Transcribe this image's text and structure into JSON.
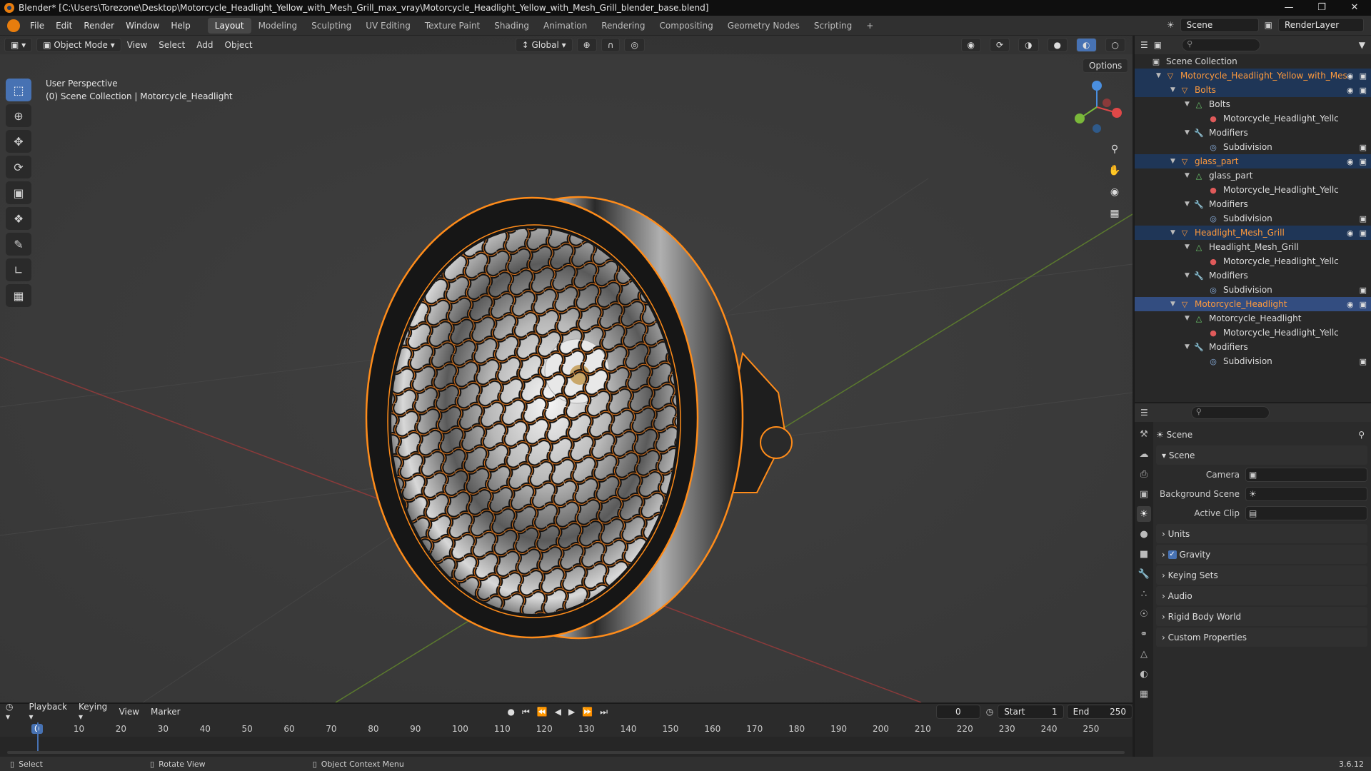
{
  "window": {
    "title": "Blender* [C:\\Users\\Torezone\\Desktop\\Motorcycle_Headlight_Yellow_with_Mesh_Grill_max_vray\\Motorcycle_Headlight_Yellow_with_Mesh_Grill_blender_base.blend]"
  },
  "menu": [
    "File",
    "Edit",
    "Render",
    "Window",
    "Help"
  ],
  "workspaces": [
    "Layout",
    "Modeling",
    "Sculpting",
    "UV Editing",
    "Texture Paint",
    "Shading",
    "Animation",
    "Rendering",
    "Compositing",
    "Geometry Nodes",
    "Scripting"
  ],
  "active_workspace": "Layout",
  "scene_name": "Scene",
  "render_layer": "RenderLayer",
  "viewport": {
    "mode": "Object Mode",
    "menus": [
      "View",
      "Select",
      "Add",
      "Object"
    ],
    "transform_orientation": "Global",
    "options_label": "Options",
    "info_line1": "User Perspective",
    "info_line2": "(0) Scene Collection | Motorcycle_Headlight"
  },
  "outliner": {
    "root": "Scene Collection",
    "rows": [
      {
        "label": "Motorcycle_Headlight_Yellow_with_Mes"
      },
      {
        "label": "Bolts"
      },
      {
        "label": "Bolts"
      },
      {
        "label": "Motorcycle_Headlight_Yellc"
      },
      {
        "label": "Modifiers"
      },
      {
        "label": "Subdivision"
      },
      {
        "label": "glass_part"
      },
      {
        "label": "glass_part"
      },
      {
        "label": "Motorcycle_Headlight_Yellc"
      },
      {
        "label": "Modifiers"
      },
      {
        "label": "Subdivision"
      },
      {
        "label": "Headlight_Mesh_Grill"
      },
      {
        "label": "Headlight_Mesh_Grill"
      },
      {
        "label": "Motorcycle_Headlight_Yellc"
      },
      {
        "label": "Modifiers"
      },
      {
        "label": "Subdivision"
      },
      {
        "label": "Motorcycle_Headlight"
      },
      {
        "label": "Motorcycle_Headlight"
      },
      {
        "label": "Motorcycle_Headlight_Yellc"
      },
      {
        "label": "Modifiers"
      },
      {
        "label": "Subdivision"
      }
    ]
  },
  "properties": {
    "context": "Scene",
    "panel_scene": "Scene",
    "camera_label": "Camera",
    "background_label": "Background Scene",
    "clip_label": "Active Clip",
    "panels": [
      "Units",
      "Gravity",
      "Keying Sets",
      "Audio",
      "Rigid Body World",
      "Custom Properties"
    ],
    "gravity_checked": true
  },
  "timeline": {
    "menus": [
      "Playback",
      "Keying",
      "View",
      "Marker"
    ],
    "current_frame": "0",
    "start_label": "Start",
    "start": "1",
    "end_label": "End",
    "end": "250",
    "ticks": [
      "0",
      "10",
      "20",
      "30",
      "40",
      "50",
      "60",
      "70",
      "80",
      "90",
      "100",
      "110",
      "120",
      "130",
      "140",
      "150",
      "160",
      "170",
      "180",
      "190",
      "200",
      "210",
      "220",
      "230",
      "240",
      "250"
    ]
  },
  "status": {
    "select": "Select",
    "rotate": "Rotate View",
    "context_menu": "Object Context Menu",
    "version": "3.6.12"
  }
}
